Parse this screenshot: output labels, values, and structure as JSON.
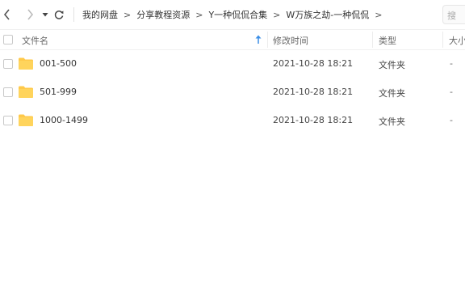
{
  "toolbar": {
    "back_icon": "chevron-left-icon",
    "forward_icon": "chevron-right-icon",
    "history_icon": "caret-down-icon",
    "refresh_icon": "refresh-icon",
    "breadcrumbs": [
      "我的网盘",
      "分享教程资源",
      "Y一种侃侃合集",
      "W万族之劫-一种侃侃"
    ],
    "separator": ">",
    "search_placeholder": "搜"
  },
  "table": {
    "headers": {
      "name": "文件名",
      "modified": "修改时间",
      "type": "类型",
      "size": "大小"
    },
    "sort_icon": "sort-up-arrow-icon",
    "rows": [
      {
        "name": "001-500",
        "modified": "2021-10-28 18:21",
        "type": "文件夹",
        "size": "-"
      },
      {
        "name": "501-999",
        "modified": "2021-10-28 18:21",
        "type": "文件夹",
        "size": "-"
      },
      {
        "name": "1000-1499",
        "modified": "2021-10-28 18:21",
        "type": "文件夹",
        "size": "-"
      }
    ]
  },
  "colors": {
    "folder": "#ffc94a",
    "accent": "#3a8ee6",
    "text": "#333333"
  }
}
